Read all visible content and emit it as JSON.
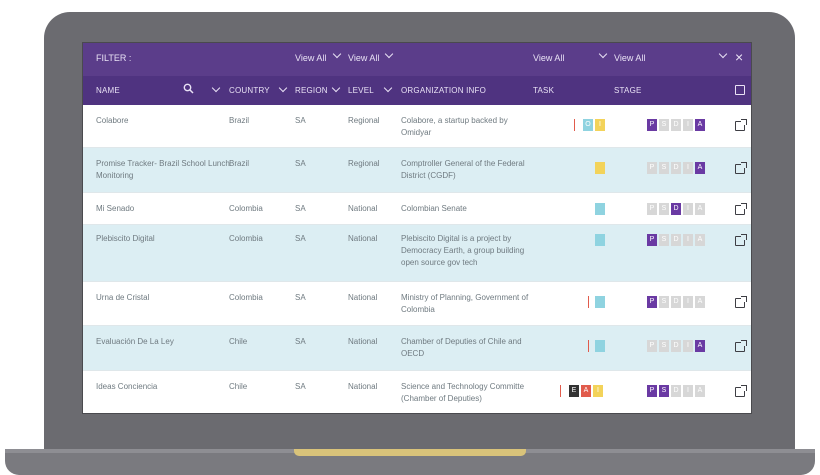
{
  "filter": {
    "label": "FILTER :",
    "view_all_1": "View All",
    "view_all_2": "View All",
    "view_all_3": "View All",
    "view_all_4": "View All",
    "close": "×"
  },
  "headers": {
    "name": "NAME",
    "country": "COUNTRY",
    "region": "REGION",
    "level": "LEVEL",
    "org": "ORGANIZATION INFO",
    "task": "TASK",
    "stage": "STAGE"
  },
  "stage_letters": [
    "P",
    "S",
    "D",
    "I",
    "A"
  ],
  "rows": [
    {
      "name": "Colabore",
      "country": "Brazil",
      "region": "SA",
      "level": "Regional",
      "org": "Colabore, a startup backed by Omidyar"
    },
    {
      "name": "Promise Tracker- Brazil School Lunch Monitoring",
      "country": "Brazil",
      "region": "SA",
      "level": "Regional",
      "org": "Comptroller General of the Federal District (CGDF)"
    },
    {
      "name": "Mi Senado",
      "country": "Colombia",
      "region": "SA",
      "level": "National",
      "org": "Colombian Senate"
    },
    {
      "name": "Plebiscito Digital",
      "country": "Colombia",
      "region": "SA",
      "level": "National",
      "org": "Plebiscito Digital is a project by Democracy Earth, a group building open source gov tech"
    },
    {
      "name": "Urna de Cristal",
      "country": "Colombia",
      "region": "SA",
      "level": "National",
      "org": "Ministry of Planning, Government of Colombia"
    },
    {
      "name": "Evaluación De La Ley",
      "country": "Chile",
      "region": "SA",
      "level": "National",
      "org": "Chamber of Deputies of Chile and OECD"
    },
    {
      "name": "Ideas Conciencia",
      "country": "Chile",
      "region": "SA",
      "level": "National",
      "org": "Science and Technology Committe (Chamber of Deputies)"
    }
  ],
  "task_badges": {
    "row0": [
      "I",
      "O",
      "I"
    ],
    "row6": [
      "E",
      "A",
      "I"
    ]
  },
  "colors": {
    "header_purple": "#4f3380",
    "filter_purple": "#5b3d8a",
    "teal": "#8fd3e0",
    "yellow": "#f3d35a",
    "red": "#e15b4c",
    "stage_active": "#6a3aa3",
    "stage_inactive": "#d7d7d7"
  }
}
